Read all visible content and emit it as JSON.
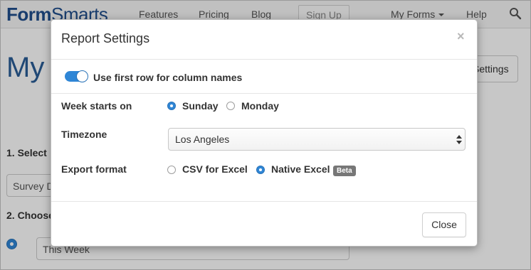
{
  "navbar": {
    "logo_dark": "Form",
    "logo_light": "Smarts",
    "links": {
      "features": "Features",
      "pricing": "Pricing",
      "blog": "Blog",
      "signup": "Sign Up",
      "my_forms": "My Forms",
      "help": "Help"
    }
  },
  "page": {
    "title_fragment": "My F",
    "settings_button": "Settings",
    "step1_fragment": "1. Select",
    "survey_select_fragment": "Survey D",
    "step2_fragment": "2. Choose",
    "range_select": "This Week"
  },
  "modal": {
    "title": "Report Settings",
    "close_x": "×",
    "toggle_label": "Use first row for column names",
    "toggle_on": true,
    "week": {
      "label": "Week starts on",
      "options": [
        "Sunday",
        "Monday"
      ],
      "selected": "Sunday"
    },
    "timezone": {
      "label": "Timezone",
      "value": "Los Angeles"
    },
    "export": {
      "label": "Export format",
      "options": [
        "CSV for Excel",
        "Native Excel"
      ],
      "selected": "Native Excel",
      "badge": "Beta"
    },
    "close_button": "Close"
  },
  "colors": {
    "accent": "#2f86d6",
    "brand": "#1f4e8c",
    "badge": "#777777"
  }
}
